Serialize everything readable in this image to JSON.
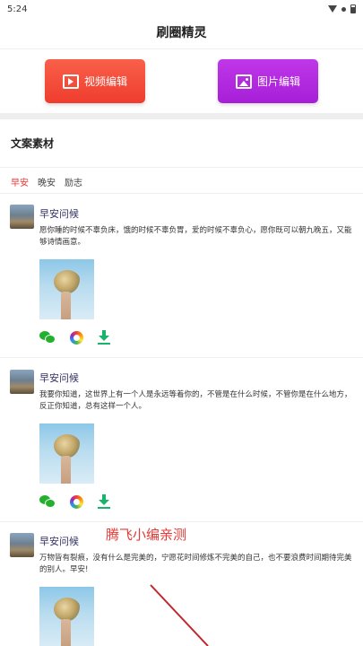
{
  "status_bar": {
    "time": "5:24"
  },
  "header": {
    "title": "刷圈精灵"
  },
  "actions": {
    "video_label": "视频编辑",
    "image_label": "图片编辑"
  },
  "section": {
    "title": "文案素材"
  },
  "tabs": [
    {
      "label": "早安",
      "active": true
    },
    {
      "label": "晚安",
      "active": false
    },
    {
      "label": "励志",
      "active": false
    }
  ],
  "posts": [
    {
      "title": "早安问候",
      "text": "愿你睡的时候不辜负床，饿的时候不辜负胃，爱的时候不辜负心，愿你既可以朝九晚五，又能够诗情画意。"
    },
    {
      "title": "早安问候",
      "text": "我要你知道，这世界上有一个人是永远等着你的，不管是在什么时候，不管你是在什么地方，反正你知道，总有这样一个人。"
    },
    {
      "title": "早安问候",
      "text": "万物皆有裂痕，没有什么是完美的，宁愿花时间修炼不完美的自己，也不要浪费时间期待完美的别人。早安!"
    }
  ],
  "watermark": {
    "text": "腾飞小编亲测"
  },
  "icons": {
    "share_wechat": "wechat-icon",
    "share_moments": "moments-icon",
    "download": "download-icon"
  },
  "colors": {
    "accent_red": "#e53935",
    "video_btn": "#f44f3d",
    "image_btn": "#b12ce0",
    "download_green": "#1ab36a",
    "wechat_green": "#22b02d"
  }
}
